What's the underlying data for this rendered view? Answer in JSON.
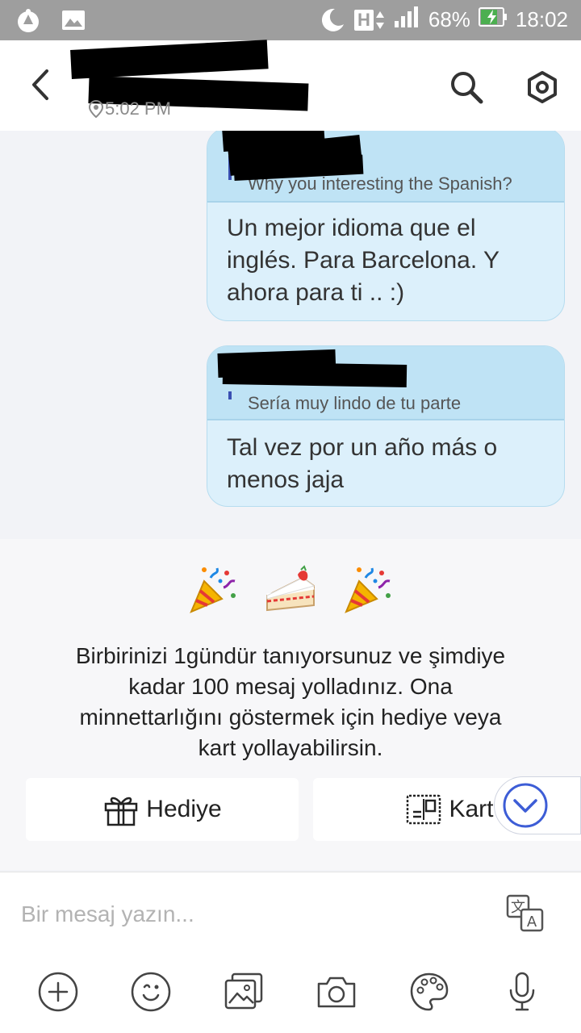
{
  "status_bar": {
    "network_type": "H",
    "battery_percent": "68%",
    "time": "18:02",
    "icons": [
      "app-notification-icon",
      "image-notification-icon",
      "do-not-disturb-moon-icon",
      "network-type-icon",
      "signal-bars-icon",
      "battery-charging-icon"
    ]
  },
  "header": {
    "subtitle_time": "5:02 PM",
    "icons": [
      "back-arrow-icon",
      "location-pin-icon",
      "search-icon",
      "settings-hexagon-icon"
    ]
  },
  "messages": [
    {
      "quoted_text": "Why you interesting the Spanish?",
      "text_lines": [
        "Un mejor idioma que el",
        "inglés. Para Barcelona. Y",
        "ahora para ti .. :)"
      ]
    },
    {
      "quoted_text": "Sería muy lindo de tu parte",
      "text_lines": [
        "Tal vez por un año más o",
        "menos jaja"
      ]
    }
  ],
  "milestone": {
    "emojis": [
      "party-popper-icon",
      "strawberry-cake-icon",
      "party-popper-icon"
    ],
    "text_lines": [
      "Birbirinizi 1gündür tanıyorsunuz ve şimdiye",
      "kadar 100 mesaj yolladınız. Ona",
      "minnettarlığını göstermek için hediye veya",
      "kart yollayabilirsin."
    ],
    "gift_label": "Hediye",
    "card_label": "Kart"
  },
  "compose": {
    "placeholder": "Bir mesaj yazın...",
    "toolbar_icons": [
      "plus-icon",
      "smiley-icon",
      "gallery-icon",
      "camera-icon",
      "palette-icon",
      "microphone-icon"
    ]
  },
  "colors": {
    "bubble_bg": "#dcf0fb",
    "quote_bg": "#bfe3f5",
    "accent_blue": "#3d5dd6",
    "status_bar": "#9e9e9e"
  }
}
